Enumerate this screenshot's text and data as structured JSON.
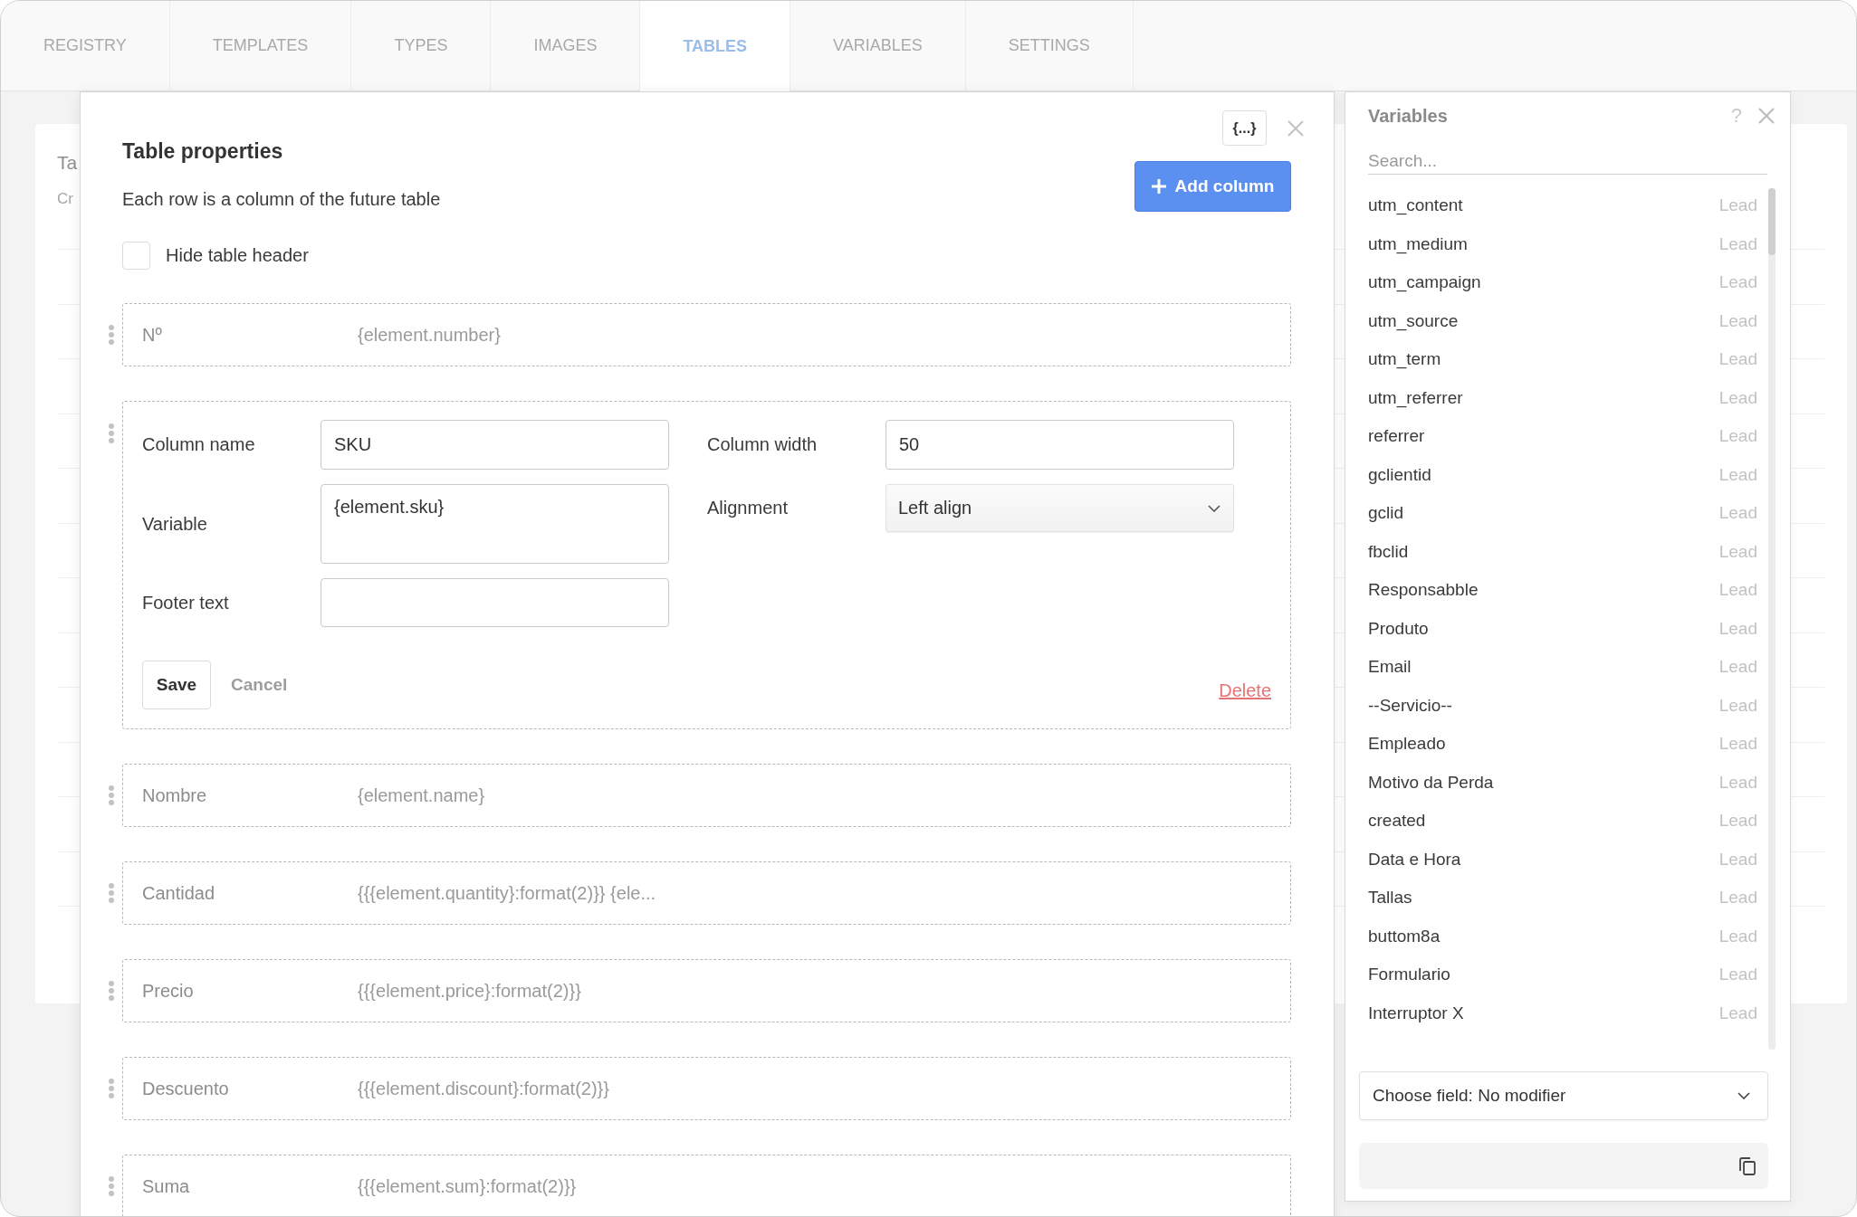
{
  "tabs": [
    {
      "label": "REGISTRY",
      "selected": false
    },
    {
      "label": "TEMPLATES",
      "selected": false
    },
    {
      "label": "TYPES",
      "selected": false
    },
    {
      "label": "IMAGES",
      "selected": false
    },
    {
      "label": "TABLES",
      "selected": true
    },
    {
      "label": "VARIABLES",
      "selected": false
    },
    {
      "label": "SETTINGS",
      "selected": false
    }
  ],
  "page": {
    "title": "Ta",
    "subtitle": "Cr"
  },
  "dialog": {
    "title": "Table properties",
    "subtitle": "Each row is a column of the future table",
    "variables_button": "{...}",
    "add_button": "Add column",
    "hide_header": {
      "label": "Hide table header",
      "checked": false
    },
    "columns": [
      {
        "kind": "collapsed",
        "name": "Nº",
        "variable": "{element.number}"
      },
      {
        "kind": "editing",
        "column_name": {
          "label": "Column name",
          "value": "SKU"
        },
        "column_width": {
          "label": "Column width",
          "value": "50"
        },
        "variable": {
          "label": "Variable",
          "value": "{element.sku}"
        },
        "alignment": {
          "label": "Alignment",
          "value": "Left align"
        },
        "footer_text": {
          "label": "Footer text"
        },
        "save": "Save",
        "cancel": "Cancel",
        "delete": "Delete"
      },
      {
        "kind": "collapsed",
        "name": "Nombre",
        "variable": "{element.name}"
      },
      {
        "kind": "collapsed",
        "name": "Cantidad",
        "variable": "{{{element.quantity}:format(2)}} {ele..."
      },
      {
        "kind": "collapsed",
        "name": "Precio",
        "variable": "{{{element.price}:format(2)}}"
      },
      {
        "kind": "collapsed",
        "name": "Descuento",
        "variable": "{{{element.discount}:format(2)}}"
      },
      {
        "kind": "collapsed",
        "name": "Suma",
        "variable": "{{{element.sum}:format(2)}}"
      }
    ]
  },
  "variables_panel": {
    "title": "Variables",
    "help": "?",
    "search": {
      "placeholder": "Search..."
    },
    "items": [
      {
        "name": "utm_content",
        "source": "Lead"
      },
      {
        "name": "utm_medium",
        "source": "Lead"
      },
      {
        "name": "utm_campaign",
        "source": "Lead"
      },
      {
        "name": "utm_source",
        "source": "Lead"
      },
      {
        "name": "utm_term",
        "source": "Lead"
      },
      {
        "name": "utm_referrer",
        "source": "Lead"
      },
      {
        "name": "referrer",
        "source": "Lead"
      },
      {
        "name": "gclientid",
        "source": "Lead"
      },
      {
        "name": "gclid",
        "source": "Lead"
      },
      {
        "name": "fbclid",
        "source": "Lead"
      },
      {
        "name": "Responsabble",
        "source": "Lead"
      },
      {
        "name": "Produto",
        "source": "Lead"
      },
      {
        "name": "Email",
        "source": "Lead"
      },
      {
        "name": "--Servicio--",
        "source": "Lead"
      },
      {
        "name": "Empleado",
        "source": "Lead"
      },
      {
        "name": "Motivo da Perda",
        "source": "Lead"
      },
      {
        "name": "created",
        "source": "Lead"
      },
      {
        "name": "Data e Hora",
        "source": "Lead"
      },
      {
        "name": "Tallas",
        "source": "Lead"
      },
      {
        "name": "buttom8a",
        "source": "Lead"
      },
      {
        "name": "Formulario",
        "source": "Lead"
      },
      {
        "name": "Interruptor X",
        "source": "Lead"
      }
    ],
    "modifier": "Choose field: No modifier"
  }
}
